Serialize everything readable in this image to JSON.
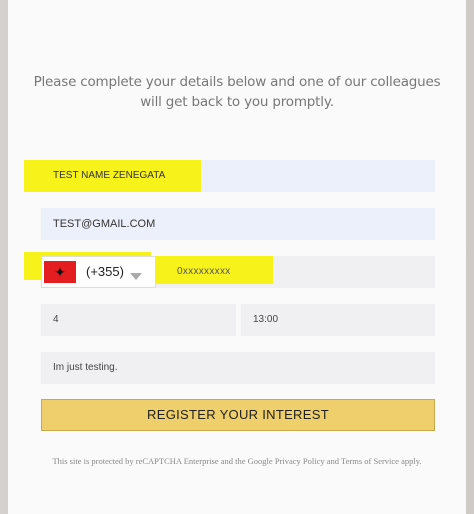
{
  "intro": {
    "line1": "Please  complete your details below and one of our colleagues",
    "line2": "will get back to you promptly."
  },
  "form": {
    "name_value": "TEST NAME ZENEGATA",
    "email_value": "TEST@GMAIL.COM",
    "country_flag": "Albania flag",
    "dial_code": "(+355)",
    "phone_value": "0xxxxxxxxx",
    "people_value": "4",
    "time_value": "13:00",
    "message_value": "Im just testing."
  },
  "submit_label": "REGISTER YOUR INTEREST",
  "legal": {
    "prefix": "This site is protected by reCAPTCHA Enterprise and the Google ",
    "privacy": "Privacy Policy",
    "and": " and ",
    "terms": "Terms of Service",
    "suffix": " apply."
  },
  "colors": {
    "highlight": "#f7f21a",
    "button": "#efcf6b",
    "field_blue": "#ecf0fb",
    "field_gray": "#f0f0f2"
  }
}
